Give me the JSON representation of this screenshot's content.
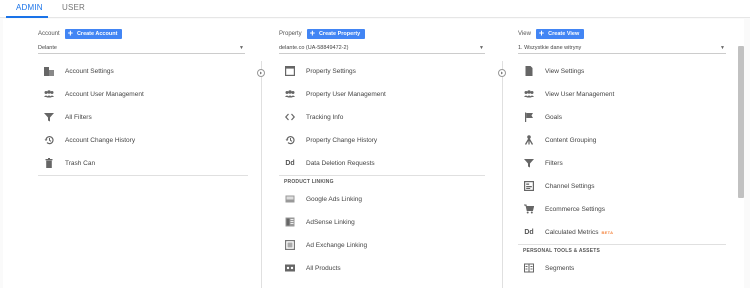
{
  "tabs": {
    "admin": "ADMIN",
    "user": "USER"
  },
  "account": {
    "label": "Account",
    "create_label": "Create Account",
    "selected": "Delante",
    "items": [
      {
        "label": "Account Settings",
        "icon": "building-icon"
      },
      {
        "label": "Account User Management",
        "icon": "users-icon"
      },
      {
        "label": "All Filters",
        "icon": "filter-icon"
      },
      {
        "label": "Account Change History",
        "icon": "history-icon"
      },
      {
        "label": "Trash Can",
        "icon": "trash-icon"
      }
    ]
  },
  "property": {
    "label": "Property",
    "create_label": "Create Property",
    "selected": "delante.co (UA-58849472-2)",
    "items": [
      {
        "label": "Property Settings",
        "icon": "window-icon"
      },
      {
        "label": "Property User Management",
        "icon": "users-icon"
      },
      {
        "label": "Tracking Info",
        "icon": "code-icon"
      },
      {
        "label": "Property Change History",
        "icon": "history-icon"
      },
      {
        "label": "Data Deletion Requests",
        "icon": "dd-icon"
      }
    ],
    "product_linking_title": "PRODUCT LINKING",
    "linking_items": [
      {
        "label": "Google Ads Linking",
        "icon": "ads-icon"
      },
      {
        "label": "AdSense Linking",
        "icon": "adsense-icon"
      },
      {
        "label": "Ad Exchange Linking",
        "icon": "adexchange-icon"
      },
      {
        "label": "All Products",
        "icon": "products-icon"
      }
    ]
  },
  "view": {
    "label": "View",
    "create_label": "Create View",
    "selected": "1. Wszystkie dane witryny",
    "items": [
      {
        "label": "View Settings",
        "icon": "document-icon"
      },
      {
        "label": "View User Management",
        "icon": "users-icon"
      },
      {
        "label": "Goals",
        "icon": "flag-icon"
      },
      {
        "label": "Content Grouping",
        "icon": "grouping-icon"
      },
      {
        "label": "Filters",
        "icon": "filter-icon"
      },
      {
        "label": "Channel Settings",
        "icon": "channel-icon"
      },
      {
        "label": "Ecommerce Settings",
        "icon": "cart-icon"
      },
      {
        "label": "Calculated Metrics",
        "icon": "dd-icon",
        "badge": "BETA"
      }
    ],
    "personal_title": "PERSONAL TOOLS & ASSETS",
    "personal_items": [
      {
        "label": "Segments",
        "icon": "segments-icon"
      }
    ]
  },
  "colors": {
    "accent": "#1a73e8",
    "button": "#4285f4",
    "beta": "#f4833d"
  }
}
